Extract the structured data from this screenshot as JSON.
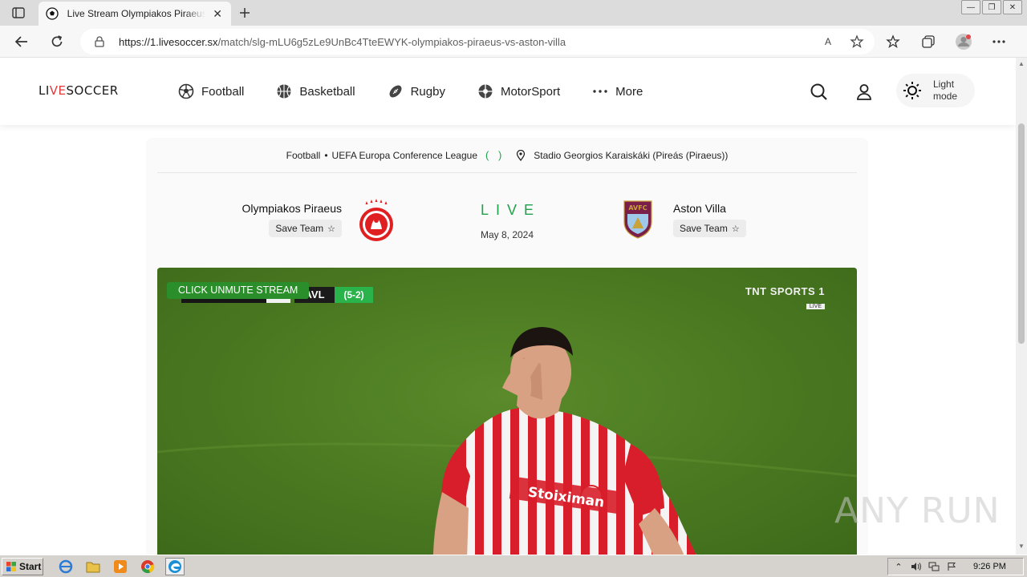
{
  "browser": {
    "tab_title": "Live Stream Olympiakos Piraeus vs Aston Villa",
    "tab_close": "✕",
    "url_host": "https://1.livesoccer.sx",
    "url_path": "/match/slg-mLU6g5zLe9UnBc4TteEWYK-olympiakos-piraeus-vs-aston-villa",
    "read_aloud": "A",
    "window_minimize": "—",
    "window_restore": "❐",
    "window_close": "✕"
  },
  "site": {
    "logo_pre": "LI",
    "logo_accent": "VE",
    "logo_post": "SOCCER",
    "nav": [
      {
        "label": "Football",
        "icon": "football-icon"
      },
      {
        "label": "Basketball",
        "icon": "basketball-icon"
      },
      {
        "label": "Rugby",
        "icon": "rugby-icon"
      },
      {
        "label": "MotorSport",
        "icon": "motorsport-icon"
      },
      {
        "label": "More",
        "icon": "more-dots-icon"
      }
    ],
    "light_mode_line1": "Light",
    "light_mode_line2": "mode"
  },
  "match": {
    "sport": "Football",
    "separator": "•",
    "competition": "UEFA Europa Conference League",
    "competition_brackets": "( )",
    "venue": "Stadio Georgios Karaiskáki (Pireás (Piraeus))",
    "home_team": "Olympiakos Piraeus",
    "away_team": "Aston Villa",
    "save_team_label": "Save Team",
    "star": "☆",
    "status": "LIVE",
    "date": "May 8, 2024",
    "away_crest_text": "AVFC",
    "colors": {
      "live_green": "#1fa34a",
      "olympiakos_red": "#e02020",
      "villa_claret": "#7a1f4a",
      "villa_blue": "#9ec9ea"
    }
  },
  "player": {
    "unmute_label": "CLICK UNMUTE STREAM",
    "score_home": "0",
    "score_team": "AVL",
    "aggregate": "(5-2)",
    "broadcaster": "TNT SPORTS 1",
    "broadcaster_live": "LIVE",
    "shirt_sponsor": "Stoiximan"
  },
  "watermark": "ANY RUN",
  "taskbar": {
    "start_label": "Start",
    "clock": "9:26 PM"
  }
}
